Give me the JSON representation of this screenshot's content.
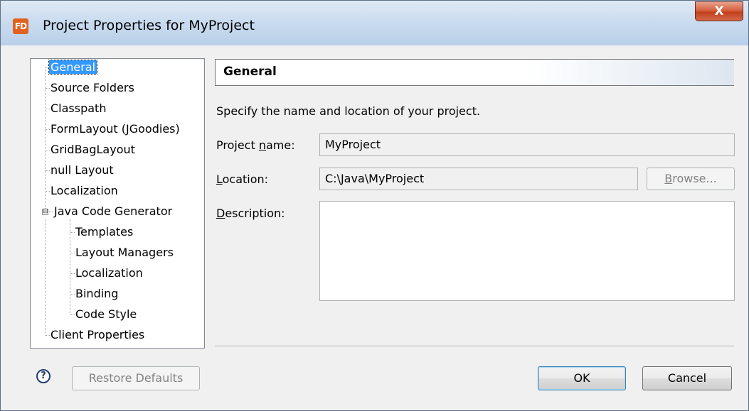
{
  "window": {
    "title": "Project Properties for MyProject",
    "close_label": "X"
  },
  "tree": {
    "items": [
      {
        "label": "General"
      },
      {
        "label": "Source Folders"
      },
      {
        "label": "Classpath"
      },
      {
        "label": "FormLayout (JGoodies)"
      },
      {
        "label": "GridBagLayout"
      },
      {
        "label": "null Layout"
      },
      {
        "label": "Localization"
      },
      {
        "label": "Java Code Generator",
        "expander": "⊟"
      },
      {
        "label": "Templates"
      },
      {
        "label": "Layout Managers"
      },
      {
        "label": "Localization"
      },
      {
        "label": "Binding"
      },
      {
        "label": "Code Style"
      },
      {
        "label": "Client Properties"
      }
    ],
    "selected": "General"
  },
  "panel": {
    "title": "General",
    "description": "Specify the name and location of your project.",
    "project_name_label_pre": "Project ",
    "project_name_label_mn": "n",
    "project_name_label_post": "ame:",
    "project_name_value": "MyProject",
    "location_label_mn": "L",
    "location_label_post": "ocation:",
    "location_value": "C:\\Java\\MyProject",
    "browse_mn": "B",
    "browse_post": "rowse...",
    "description_label_mn": "D",
    "description_label_post": "escription:",
    "description_value": ""
  },
  "footer": {
    "help_glyph": "?",
    "restore_defaults_label": "Restore Defaults",
    "ok_label": "OK",
    "cancel_label": "Cancel"
  },
  "colors": {
    "selection": "#3399ff",
    "dialog_bg": "#f0f0f0",
    "close_button": "#c3401c"
  }
}
